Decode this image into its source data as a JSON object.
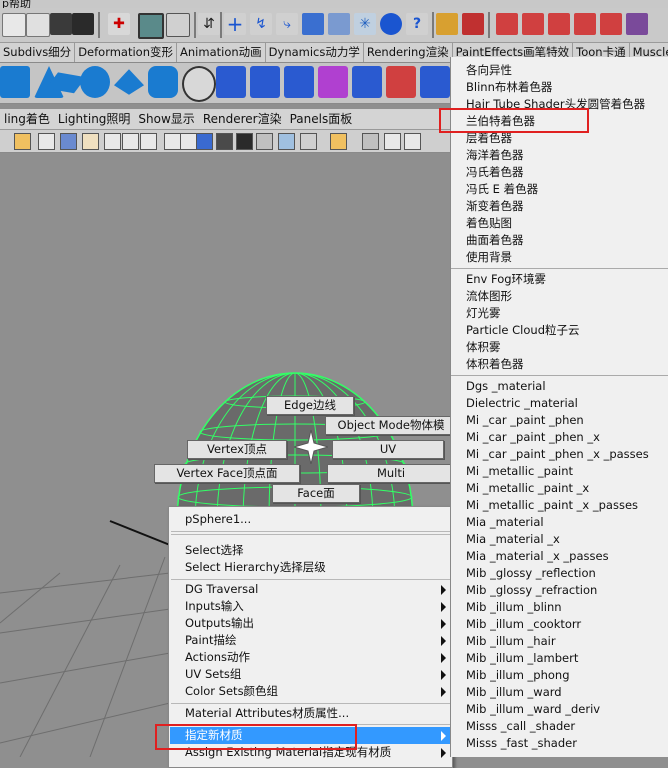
{
  "title_fragment": "p帮助",
  "shelf_tabs": [
    "Subdivs细分",
    "Deformation变形",
    "Animation动画",
    "Dynamics动力学",
    "Rendering渲染",
    "PaintEffects画笔特效",
    "Toon卡通",
    "Muscle肌肉"
  ],
  "panel_menu": [
    "ling着色",
    "Lighting照明",
    "Show显示",
    "Renderer渲染",
    "Panels面板"
  ],
  "marking_menu": {
    "edge": "Edge边线",
    "object_mode": "Object Mode物体模",
    "vertex": "Vertex顶点",
    "uv": "UV",
    "vertex_face": "Vertex Face顶点面",
    "multi": "Multi",
    "face": "Face面"
  },
  "context_menu": {
    "object": "pSphere1...",
    "select": "Select选择",
    "select_hierarchy": "Select Hierarchy选择层级",
    "dg_traversal": "DG Traversal",
    "inputs": "Inputs输入",
    "outputs": "Outputs输出",
    "paint": "Paint描绘",
    "actions": "Actions动作",
    "uv_sets": "UV Sets组",
    "color_sets": "Color Sets颜色组",
    "material_attributes": "Material Attributes材质属性...",
    "assign_new_material": "指定新材质",
    "assign_existing_material": "Assign Existing Material指定现有材质"
  },
  "material_submenu": {
    "group1": [
      "各向异性",
      "Blinn布林着色器",
      "Hair Tube Shader头发圆管着色器",
      "兰伯特着色器",
      "层着色器",
      "海洋着色器",
      "冯氏着色器",
      "冯氏 E 着色器",
      "渐变着色器",
      "着色贴图",
      "曲面着色器",
      "使用背景"
    ],
    "group2": [
      "Env Fog环境雾",
      "流体图形",
      "灯光雾",
      "Particle Cloud粒子云",
      "体积雾",
      "体积着色器"
    ],
    "group3": [
      "Dgs _material",
      "Dielectric _material",
      "Mi _car _paint _phen",
      "Mi _car _paint _phen _x",
      "Mi _car _paint _phen _x _passes",
      "Mi _metallic _paint",
      "Mi _metallic _paint _x",
      "Mi _metallic _paint _x _passes",
      "Mia _material",
      "Mia _material _x",
      "Mia _material _x _passes",
      "Mib _glossy _reflection",
      "Mib _glossy _refraction",
      "Mib _illum _blinn",
      "Mib _illum _cooktorr",
      "Mib _illum _hair",
      "Mib _illum _lambert",
      "Mib _illum _phong",
      "Mib _illum _ward",
      "Mib _illum _ward _deriv",
      "Misss _call _shader",
      "Misss _fast _shader"
    ]
  },
  "colors": {
    "highlight": "#3399ff",
    "annotation_red": "#e02020",
    "sphere_wire": "#33ff66",
    "viewport_bg": "#8f8f8f"
  }
}
